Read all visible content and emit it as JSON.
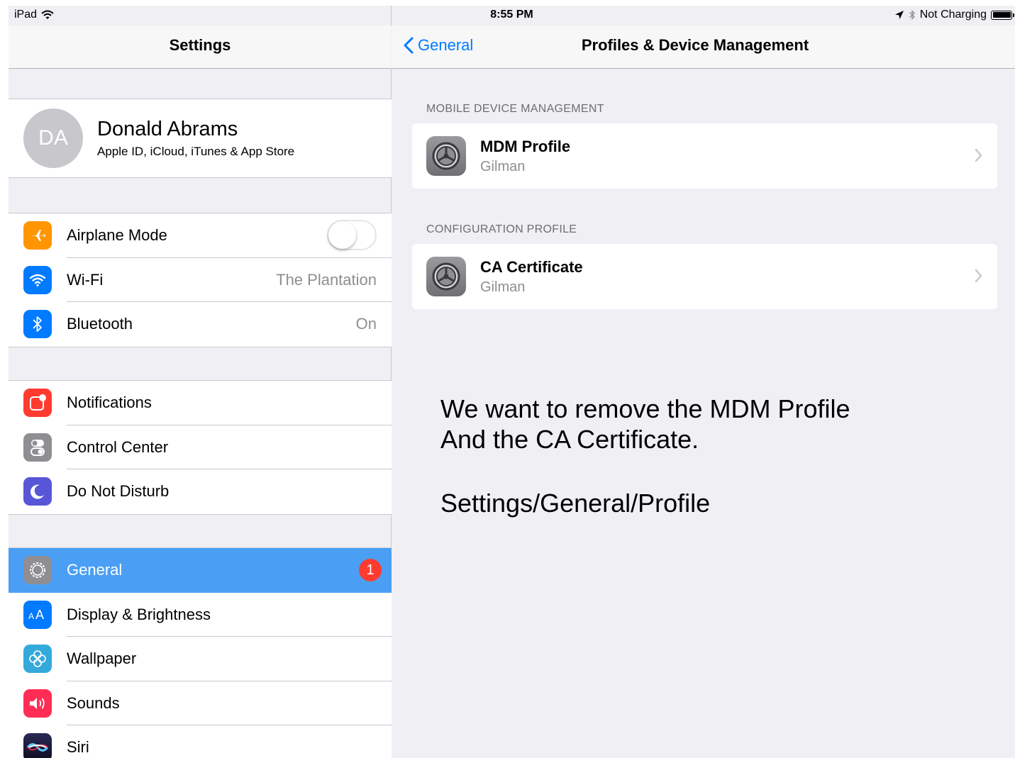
{
  "status_bar": {
    "device": "iPad",
    "time": "8:55 PM",
    "charging": "Not Charging"
  },
  "master": {
    "title": "Settings",
    "profile": {
      "initials": "DA",
      "name": "Donald Abrams",
      "subtitle": "Apple ID, iCloud, iTunes & App Store"
    },
    "group1": [
      {
        "label": "Airplane Mode",
        "icon": "airplane-icon",
        "color": "#ff9500",
        "toggle": false
      },
      {
        "label": "Wi-Fi",
        "icon": "wifi-icon",
        "color": "#007aff",
        "value": "The Plantation"
      },
      {
        "label": "Bluetooth",
        "icon": "bluetooth-icon",
        "color": "#007aff",
        "value": "On"
      }
    ],
    "group2": [
      {
        "label": "Notifications",
        "icon": "notifications-icon",
        "color": "#ff3b30"
      },
      {
        "label": "Control Center",
        "icon": "control-center-icon",
        "color": "#8e8e93"
      },
      {
        "label": "Do Not Disturb",
        "icon": "moon-icon",
        "color": "#5856d6"
      }
    ],
    "group3": [
      {
        "label": "General",
        "icon": "gear-icon",
        "color": "#8e8e93",
        "badge": "1",
        "selected": true
      },
      {
        "label": "Display & Brightness",
        "icon": "display-icon",
        "color": "#007aff"
      },
      {
        "label": "Wallpaper",
        "icon": "wallpaper-icon",
        "color": "#34aadc"
      },
      {
        "label": "Sounds",
        "icon": "sounds-icon",
        "color": "#ff2d55"
      },
      {
        "label": "Siri",
        "icon": "siri-icon",
        "color": "#1c1c3c"
      }
    ]
  },
  "detail": {
    "back_label": "General",
    "title": "Profiles & Device Management",
    "sections": [
      {
        "header": "MOBILE DEVICE MANAGEMENT",
        "item": {
          "name": "MDM Profile",
          "org": "Gilman"
        }
      },
      {
        "header": "CONFIGURATION PROFILE",
        "item": {
          "name": "CA Certificate",
          "org": "Gilman"
        }
      }
    ],
    "note": {
      "line1": "We want to remove the MDM Profile",
      "line2": "And the CA Certificate.",
      "line3": "Settings/General/Profile"
    }
  },
  "colors": {
    "accent": "#007aff",
    "selected_row": "#4a9ff5",
    "badge": "#ff3b30"
  }
}
